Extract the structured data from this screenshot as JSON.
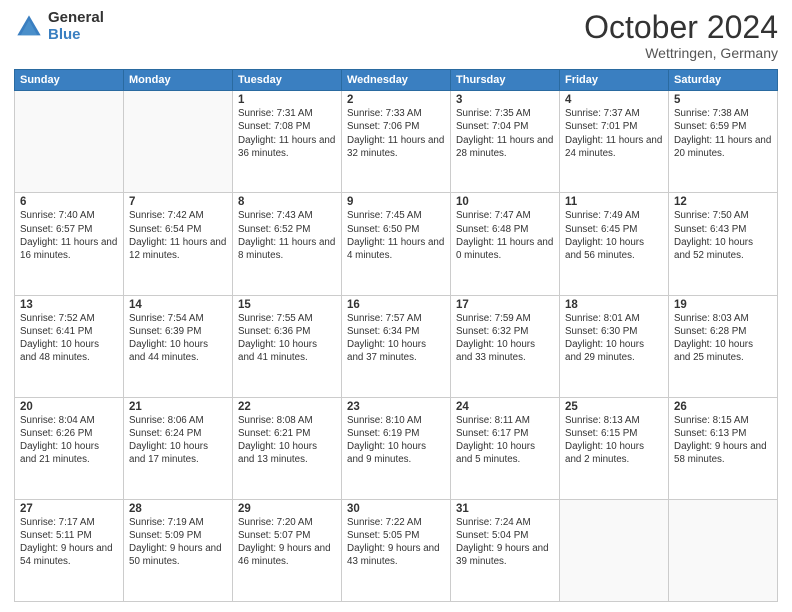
{
  "header": {
    "logo_general": "General",
    "logo_blue": "Blue",
    "month_title": "October 2024",
    "location": "Wettringen, Germany"
  },
  "weekdays": [
    "Sunday",
    "Monday",
    "Tuesday",
    "Wednesday",
    "Thursday",
    "Friday",
    "Saturday"
  ],
  "weeks": [
    [
      {
        "day": "",
        "sunrise": "",
        "sunset": "",
        "daylight": ""
      },
      {
        "day": "",
        "sunrise": "",
        "sunset": "",
        "daylight": ""
      },
      {
        "day": "1",
        "sunrise": "Sunrise: 7:31 AM",
        "sunset": "Sunset: 7:08 PM",
        "daylight": "Daylight: 11 hours and 36 minutes."
      },
      {
        "day": "2",
        "sunrise": "Sunrise: 7:33 AM",
        "sunset": "Sunset: 7:06 PM",
        "daylight": "Daylight: 11 hours and 32 minutes."
      },
      {
        "day": "3",
        "sunrise": "Sunrise: 7:35 AM",
        "sunset": "Sunset: 7:04 PM",
        "daylight": "Daylight: 11 hours and 28 minutes."
      },
      {
        "day": "4",
        "sunrise": "Sunrise: 7:37 AM",
        "sunset": "Sunset: 7:01 PM",
        "daylight": "Daylight: 11 hours and 24 minutes."
      },
      {
        "day": "5",
        "sunrise": "Sunrise: 7:38 AM",
        "sunset": "Sunset: 6:59 PM",
        "daylight": "Daylight: 11 hours and 20 minutes."
      }
    ],
    [
      {
        "day": "6",
        "sunrise": "Sunrise: 7:40 AM",
        "sunset": "Sunset: 6:57 PM",
        "daylight": "Daylight: 11 hours and 16 minutes."
      },
      {
        "day": "7",
        "sunrise": "Sunrise: 7:42 AM",
        "sunset": "Sunset: 6:54 PM",
        "daylight": "Daylight: 11 hours and 12 minutes."
      },
      {
        "day": "8",
        "sunrise": "Sunrise: 7:43 AM",
        "sunset": "Sunset: 6:52 PM",
        "daylight": "Daylight: 11 hours and 8 minutes."
      },
      {
        "day": "9",
        "sunrise": "Sunrise: 7:45 AM",
        "sunset": "Sunset: 6:50 PM",
        "daylight": "Daylight: 11 hours and 4 minutes."
      },
      {
        "day": "10",
        "sunrise": "Sunrise: 7:47 AM",
        "sunset": "Sunset: 6:48 PM",
        "daylight": "Daylight: 11 hours and 0 minutes."
      },
      {
        "day": "11",
        "sunrise": "Sunrise: 7:49 AM",
        "sunset": "Sunset: 6:45 PM",
        "daylight": "Daylight: 10 hours and 56 minutes."
      },
      {
        "day": "12",
        "sunrise": "Sunrise: 7:50 AM",
        "sunset": "Sunset: 6:43 PM",
        "daylight": "Daylight: 10 hours and 52 minutes."
      }
    ],
    [
      {
        "day": "13",
        "sunrise": "Sunrise: 7:52 AM",
        "sunset": "Sunset: 6:41 PM",
        "daylight": "Daylight: 10 hours and 48 minutes."
      },
      {
        "day": "14",
        "sunrise": "Sunrise: 7:54 AM",
        "sunset": "Sunset: 6:39 PM",
        "daylight": "Daylight: 10 hours and 44 minutes."
      },
      {
        "day": "15",
        "sunrise": "Sunrise: 7:55 AM",
        "sunset": "Sunset: 6:36 PM",
        "daylight": "Daylight: 10 hours and 41 minutes."
      },
      {
        "day": "16",
        "sunrise": "Sunrise: 7:57 AM",
        "sunset": "Sunset: 6:34 PM",
        "daylight": "Daylight: 10 hours and 37 minutes."
      },
      {
        "day": "17",
        "sunrise": "Sunrise: 7:59 AM",
        "sunset": "Sunset: 6:32 PM",
        "daylight": "Daylight: 10 hours and 33 minutes."
      },
      {
        "day": "18",
        "sunrise": "Sunrise: 8:01 AM",
        "sunset": "Sunset: 6:30 PM",
        "daylight": "Daylight: 10 hours and 29 minutes."
      },
      {
        "day": "19",
        "sunrise": "Sunrise: 8:03 AM",
        "sunset": "Sunset: 6:28 PM",
        "daylight": "Daylight: 10 hours and 25 minutes."
      }
    ],
    [
      {
        "day": "20",
        "sunrise": "Sunrise: 8:04 AM",
        "sunset": "Sunset: 6:26 PM",
        "daylight": "Daylight: 10 hours and 21 minutes."
      },
      {
        "day": "21",
        "sunrise": "Sunrise: 8:06 AM",
        "sunset": "Sunset: 6:24 PM",
        "daylight": "Daylight: 10 hours and 17 minutes."
      },
      {
        "day": "22",
        "sunrise": "Sunrise: 8:08 AM",
        "sunset": "Sunset: 6:21 PM",
        "daylight": "Daylight: 10 hours and 13 minutes."
      },
      {
        "day": "23",
        "sunrise": "Sunrise: 8:10 AM",
        "sunset": "Sunset: 6:19 PM",
        "daylight": "Daylight: 10 hours and 9 minutes."
      },
      {
        "day": "24",
        "sunrise": "Sunrise: 8:11 AM",
        "sunset": "Sunset: 6:17 PM",
        "daylight": "Daylight: 10 hours and 5 minutes."
      },
      {
        "day": "25",
        "sunrise": "Sunrise: 8:13 AM",
        "sunset": "Sunset: 6:15 PM",
        "daylight": "Daylight: 10 hours and 2 minutes."
      },
      {
        "day": "26",
        "sunrise": "Sunrise: 8:15 AM",
        "sunset": "Sunset: 6:13 PM",
        "daylight": "Daylight: 9 hours and 58 minutes."
      }
    ],
    [
      {
        "day": "27",
        "sunrise": "Sunrise: 7:17 AM",
        "sunset": "Sunset: 5:11 PM",
        "daylight": "Daylight: 9 hours and 54 minutes."
      },
      {
        "day": "28",
        "sunrise": "Sunrise: 7:19 AM",
        "sunset": "Sunset: 5:09 PM",
        "daylight": "Daylight: 9 hours and 50 minutes."
      },
      {
        "day": "29",
        "sunrise": "Sunrise: 7:20 AM",
        "sunset": "Sunset: 5:07 PM",
        "daylight": "Daylight: 9 hours and 46 minutes."
      },
      {
        "day": "30",
        "sunrise": "Sunrise: 7:22 AM",
        "sunset": "Sunset: 5:05 PM",
        "daylight": "Daylight: 9 hours and 43 minutes."
      },
      {
        "day": "31",
        "sunrise": "Sunrise: 7:24 AM",
        "sunset": "Sunset: 5:04 PM",
        "daylight": "Daylight: 9 hours and 39 minutes."
      },
      {
        "day": "",
        "sunrise": "",
        "sunset": "",
        "daylight": ""
      },
      {
        "day": "",
        "sunrise": "",
        "sunset": "",
        "daylight": ""
      }
    ]
  ]
}
